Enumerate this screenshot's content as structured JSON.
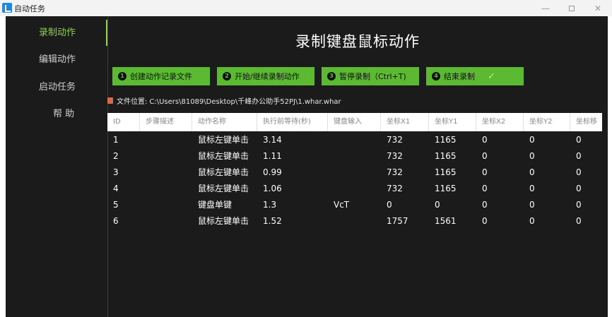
{
  "window": {
    "title": "自动任务",
    "minimize_glyph": "—",
    "close_glyph": "✕"
  },
  "sidebar": {
    "items": [
      {
        "label": "录制动作",
        "active": true
      },
      {
        "label": "编辑动作",
        "active": false
      },
      {
        "label": "启动任务",
        "active": false
      },
      {
        "label": "帮 助",
        "active": false
      }
    ]
  },
  "main": {
    "title": "录制键盘鼠标动作",
    "buttons": [
      {
        "number": "1",
        "label": "创建动作记录文件"
      },
      {
        "number": "2",
        "label": "开始/继续录制动作"
      },
      {
        "number": "3",
        "label": "暂停录制（Ctrl+T)"
      },
      {
        "number": "4",
        "label": "结束录制",
        "check": "✓"
      }
    ],
    "file": {
      "label": "文件位置:",
      "path": "C:\\Users\\81089\\Desktop\\千峰办公助手52PJ\\1.whar.whar"
    },
    "table": {
      "columns": [
        "ID",
        "步骤描述",
        "动作名称",
        "执行前等待(秒)",
        "键盘输入",
        "坐标X1",
        "坐标Y1",
        "坐标X2",
        "坐标Y2",
        "坐标移"
      ],
      "rows": [
        [
          "1",
          "",
          "鼠标左键单击",
          "3.14",
          "",
          "732",
          "1165",
          "0",
          "0",
          "0"
        ],
        [
          "2",
          "",
          "鼠标左键单击",
          "1.11",
          "",
          "732",
          "1165",
          "0",
          "0",
          "0"
        ],
        [
          "3",
          "",
          "鼠标左键单击",
          "0.99",
          "",
          "732",
          "1165",
          "0",
          "0",
          "0"
        ],
        [
          "4",
          "",
          "鼠标左键单击",
          "1.06",
          "",
          "732",
          "1165",
          "0",
          "0",
          "0"
        ],
        [
          "5",
          "",
          "键盘单键",
          "1.3",
          "VcT",
          "0",
          "0",
          "0",
          "0",
          "0"
        ],
        [
          "6",
          "",
          "鼠标左键单击",
          "1.52",
          "",
          "1757",
          "1561",
          "0",
          "0",
          "0"
        ]
      ]
    }
  },
  "colors": {
    "accent_green": "#5cb932",
    "active_nav": "#8bd44c",
    "background": "#1b1b1b"
  }
}
